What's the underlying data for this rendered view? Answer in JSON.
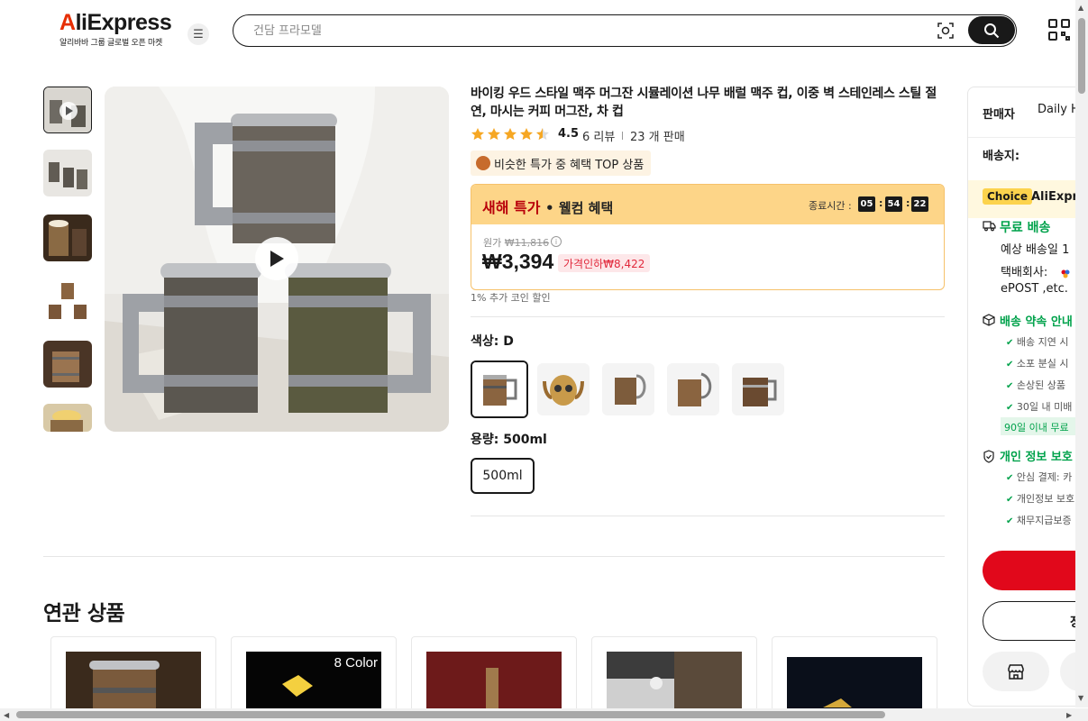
{
  "header": {
    "logo_text_a": "A",
    "logo_text_rest": "liExpress",
    "logo_sub": "알리바바 그룹 글로벌 오픈 마켓",
    "search_placeholder": "건담 프라모델"
  },
  "product": {
    "title": "바이킹 우드 스타일 맥주 머그잔 시뮬레이션 나무 배럴 맥주 컵, 이중 벽 스테인레스 스틸 절연, 마시는 커피 머그잔, 차 컵",
    "rating": "4.5",
    "reviews": "6 리뷰",
    "sold": "23 개 판매",
    "badge": "비슷한 특가 중 혜택 TOP 상품",
    "deal_title": "새해 특가",
    "deal_welcome": "• 웰컴 혜택",
    "ends_label": "종료시간 :",
    "timer_h": "05",
    "timer_m": "54",
    "timer_s": "22",
    "orig_label": "원가",
    "orig_price": "₩11,816",
    "price": "₩3,394",
    "discount": "가격인하₩8,422",
    "coin": "1% 추가 코인 할인",
    "color_label": "색상: D",
    "capacity_label": "용량: 500ml",
    "size_option": "500ml"
  },
  "related": {
    "heading": "연관 상품",
    "card2_caption": "8 Color"
  },
  "panel": {
    "seller_label": "판매자",
    "seller_value": "Daily H",
    "ship_to_label": "배송지:",
    "choice_tag": "Choice",
    "choice_text": "AliExpr",
    "free_ship": "무료 배송",
    "eta": "예상 배송일 1",
    "carrier_label": "택배회사:",
    "carrier_value": "ePOST ,etc.",
    "promise": "배송 약속 안내",
    "promise_items": [
      "배송 지연 시",
      "소포 분실 시",
      "손상된 상품",
      "30일 내 미배"
    ],
    "return_badge": "90일 이내 무료",
    "privacy": "개인 정보 보호",
    "privacy_items": [
      "안심 결제: 카",
      "개인정보 보호",
      "채무지급보증"
    ],
    "cart_text": "장"
  }
}
